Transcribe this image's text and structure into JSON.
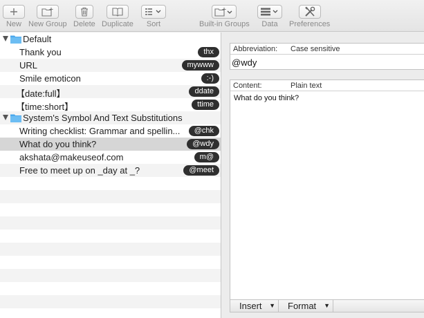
{
  "toolbar": {
    "new_label": "New",
    "new_group_label": "New Group",
    "delete_label": "Delete",
    "duplicate_label": "Duplicate",
    "sort_label": "Sort",
    "builtin_groups_label": "Built-in Groups",
    "data_label": "Data",
    "preferences_label": "Preferences"
  },
  "groups": {
    "default": {
      "name": "Default",
      "items": [
        {
          "label": "Thank you",
          "abbr": "thx"
        },
        {
          "label": "URL",
          "abbr": "mywww"
        },
        {
          "label": "Smile emoticon",
          "abbr": ":-)"
        },
        {
          "label": "【date:full】",
          "abbr": "ddate"
        },
        {
          "label": "【time:short】",
          "abbr": "ttime"
        }
      ]
    },
    "system": {
      "name": "System's Symbol And Text Substitutions",
      "items": [
        {
          "label": "Writing checklist: Grammar and spellin...",
          "abbr": "@chk"
        },
        {
          "label": "What do you think?",
          "abbr": "@wdy"
        },
        {
          "label": "akshata@makeuseof.com",
          "abbr": "m@"
        },
        {
          "label": "Free to meet up on _day at _?",
          "abbr": "@meet"
        }
      ]
    }
  },
  "editor": {
    "abbreviation_header": "Abbreviation:",
    "case_option": "Case sensitive",
    "abbreviation_value": "@wdy",
    "content_header": "Content:",
    "content_type": "Plain text",
    "content_value": "What do you think?",
    "insert_label": "Insert",
    "format_label": "Format"
  },
  "colors": {
    "selection": "#d6d6d6",
    "pill": "#2f2f2f",
    "folder": "#4aa8ec"
  }
}
